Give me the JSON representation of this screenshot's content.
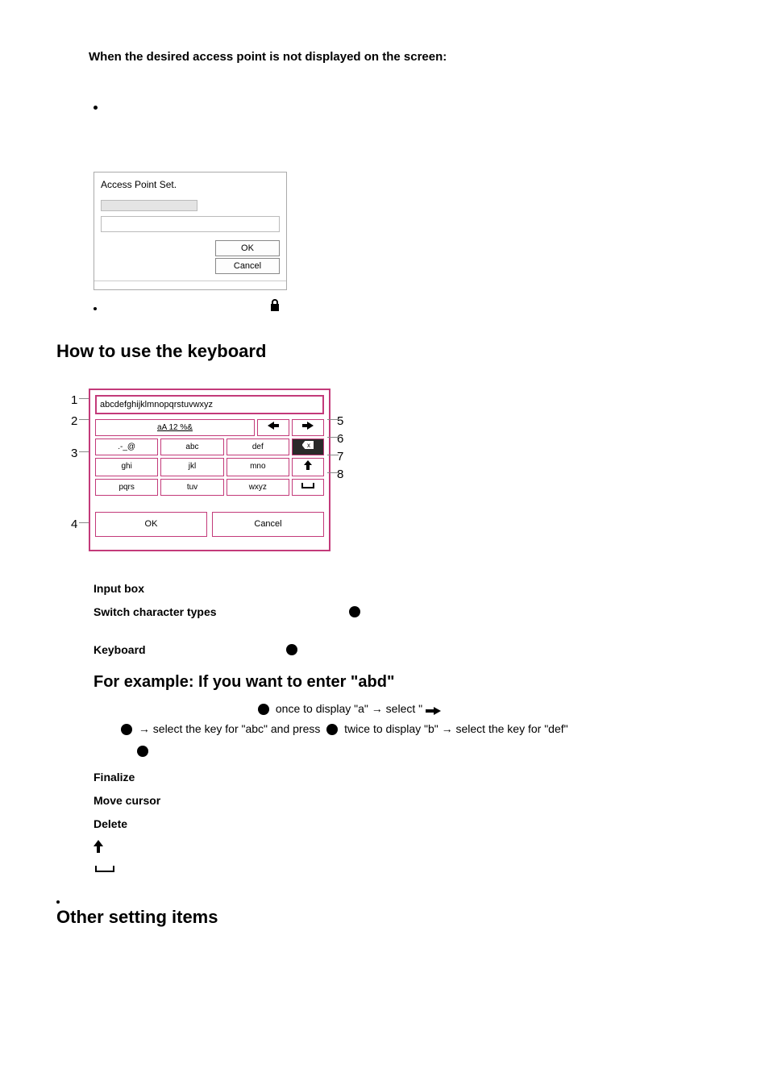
{
  "heading1": "When the desired access point is not displayed on the screen:",
  "apDialog": {
    "title": "Access Point Set.",
    "ok": "OK",
    "cancel": "Cancel"
  },
  "kbSection": "How to use the keyboard",
  "kb": {
    "textfield": "abcdefghijklmnopqrstuvwxyz",
    "modeRow": "aA   12   %&",
    "r1": [
      ".-_@",
      "abc",
      "def"
    ],
    "r2": [
      "ghi",
      "jkl",
      "mno"
    ],
    "r3": [
      "pqrs",
      "tuv",
      "wxyz"
    ],
    "ok": "OK",
    "cancel": "Cancel",
    "numsLeft": [
      "1",
      "2",
      "3",
      "4"
    ],
    "numsRight": [
      "5",
      "6",
      "7",
      "8"
    ]
  },
  "defs": {
    "t1": "Input box",
    "t2": "Switch character types",
    "t3": "Keyboard",
    "example": "For example: If you want to enter \"abd\"",
    "flow_a": " once to display \"a\" → select \" ",
    "flow_b": " → select the key for \"abc\" and press ",
    "flow_c": " twice to display \"b\" → select the key for \"def\"",
    "t4": "Finalize",
    "t5": "Move cursor",
    "t6": "Delete"
  },
  "otherTitle": "Other setting items"
}
